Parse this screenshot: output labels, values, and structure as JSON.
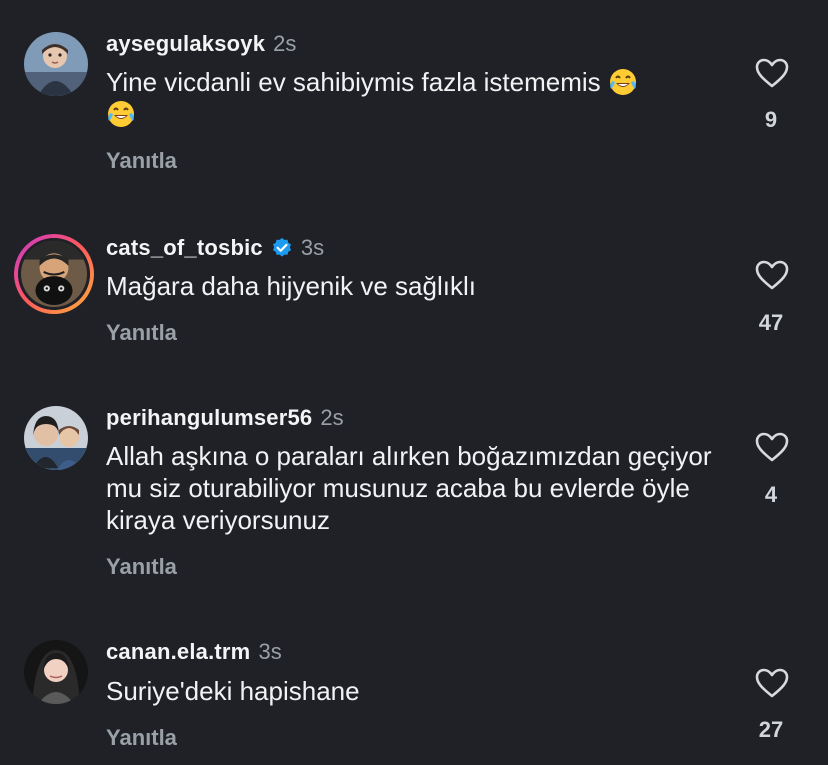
{
  "reply_label": "Yanıtla",
  "colors": {
    "background": "#1f2126",
    "muted": "#9aa0a8",
    "text": "#f1f2f4",
    "verified": "#1d9bf0"
  },
  "comments": [
    {
      "username": "aysegulaksoyk",
      "time": "2s",
      "text": "Yine vicdanli ev sahibiymis fazla istememis",
      "emoji": "face-with-tears-of-joy",
      "likes": "9",
      "avatar": "child-photo"
    },
    {
      "username": "cats_of_tosbic",
      "verified": true,
      "time": "3s",
      "text": "Mağara daha hijyenik ve sağlıklı",
      "likes": "47",
      "avatar": "cat-photo"
    },
    {
      "username": "perihangulumser56",
      "time": "2s",
      "text": "Allah aşkına o paraları alırken boğazımızdan geçiyor mu siz oturabiliyor musunuz acaba bu evlerde öyle kiraya veriyorsunuz",
      "likes": "4",
      "avatar": "two-people-photo"
    },
    {
      "username": "canan.ela.trm",
      "time": "3s",
      "text": "Suriye'deki hapishane",
      "likes": "27",
      "avatar": "woman-photo"
    }
  ]
}
